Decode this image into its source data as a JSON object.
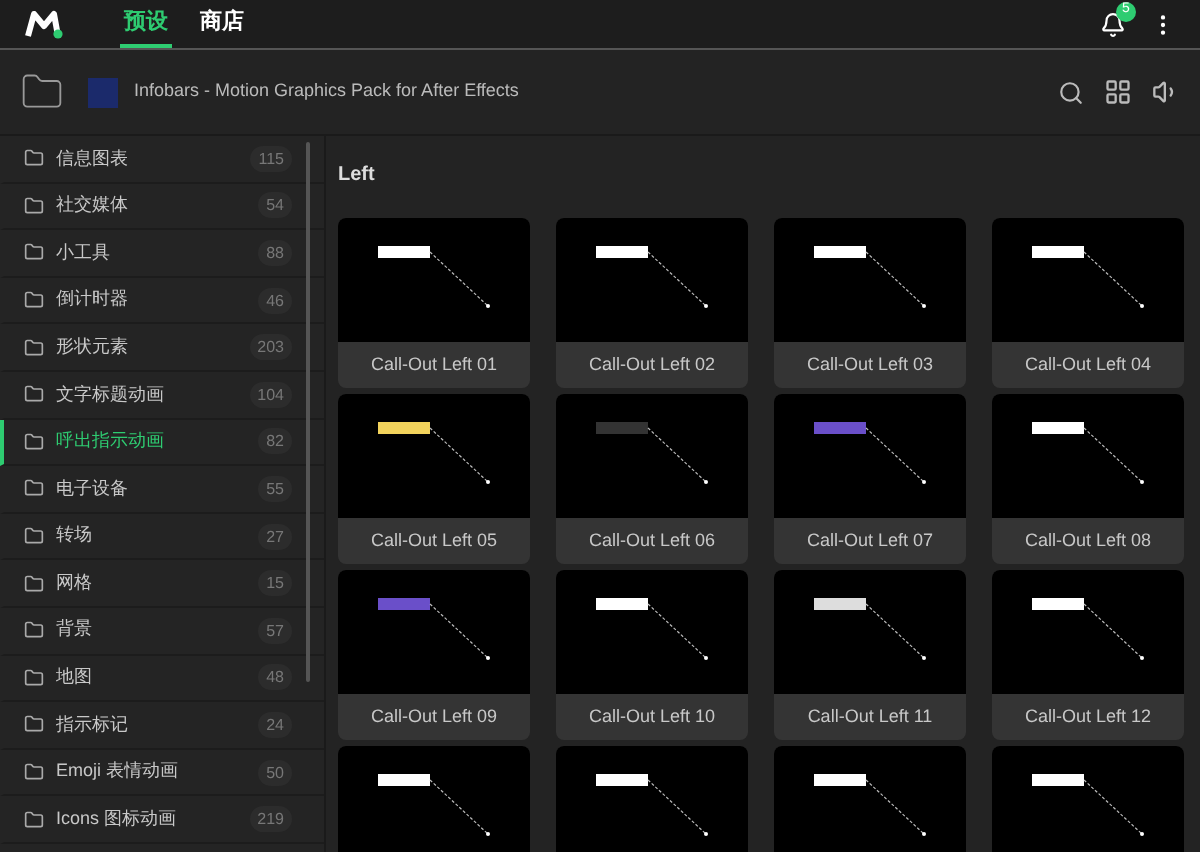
{
  "top_bar": {
    "tabs": [
      {
        "label": "预设",
        "selected": true
      },
      {
        "label": "商店",
        "selected": false
      }
    ],
    "notifications": {
      "count": "5"
    }
  },
  "header": {
    "title": "Infobars - Motion Graphics Pack for After Effects"
  },
  "sidebar": {
    "items": [
      {
        "name": "信息图表",
        "count": "115",
        "selected": false
      },
      {
        "name": "社交媒体",
        "count": "54",
        "selected": false
      },
      {
        "name": "小工具",
        "count": "88",
        "selected": false
      },
      {
        "name": "倒计时器",
        "count": "46",
        "selected": false
      },
      {
        "name": "形状元素",
        "count": "203",
        "selected": false
      },
      {
        "name": "文字标题动画",
        "count": "104",
        "selected": false
      },
      {
        "name": "呼出指示动画",
        "count": "82",
        "selected": true
      },
      {
        "name": "电子设备",
        "count": "55",
        "selected": false
      },
      {
        "name": "转场",
        "count": "27",
        "selected": false
      },
      {
        "name": "网格",
        "count": "15",
        "selected": false
      },
      {
        "name": "背景",
        "count": "57",
        "selected": false
      },
      {
        "name": "地图",
        "count": "48",
        "selected": false
      },
      {
        "name": "指示标记",
        "count": "24",
        "selected": false
      },
      {
        "name": "Emoji 表情动画",
        "count": "50",
        "selected": false
      },
      {
        "name": "Icons 图标动画",
        "count": "219",
        "selected": false
      }
    ]
  },
  "content": {
    "section_title": "Left",
    "presets": [
      {
        "label": "Call-Out Left 01",
        "color": "#ffffff"
      },
      {
        "label": "Call-Out Left 02",
        "color": "#ffffff"
      },
      {
        "label": "Call-Out Left 03",
        "color": "#ffffff"
      },
      {
        "label": "Call-Out Left 04",
        "color": "#ffffff"
      },
      {
        "label": "Call-Out Left 05",
        "color": "#f2d35c"
      },
      {
        "label": "Call-Out Left 06",
        "color": "#333333"
      },
      {
        "label": "Call-Out Left 07",
        "color": "#6a4fc9"
      },
      {
        "label": "Call-Out Left 08",
        "color": "#ffffff"
      },
      {
        "label": "Call-Out Left 09",
        "color": "#6a4fc9"
      },
      {
        "label": "Call-Out Left 10",
        "color": "#ffffff"
      },
      {
        "label": "Call-Out Left 11",
        "color": "#dddddd"
      },
      {
        "label": "Call-Out Left 12",
        "color": "#ffffff"
      },
      {
        "color": "#ffffff"
      },
      {
        "color": "#ffffff"
      },
      {
        "color": "#ffffff"
      },
      {
        "color": "#ffffff"
      }
    ]
  }
}
